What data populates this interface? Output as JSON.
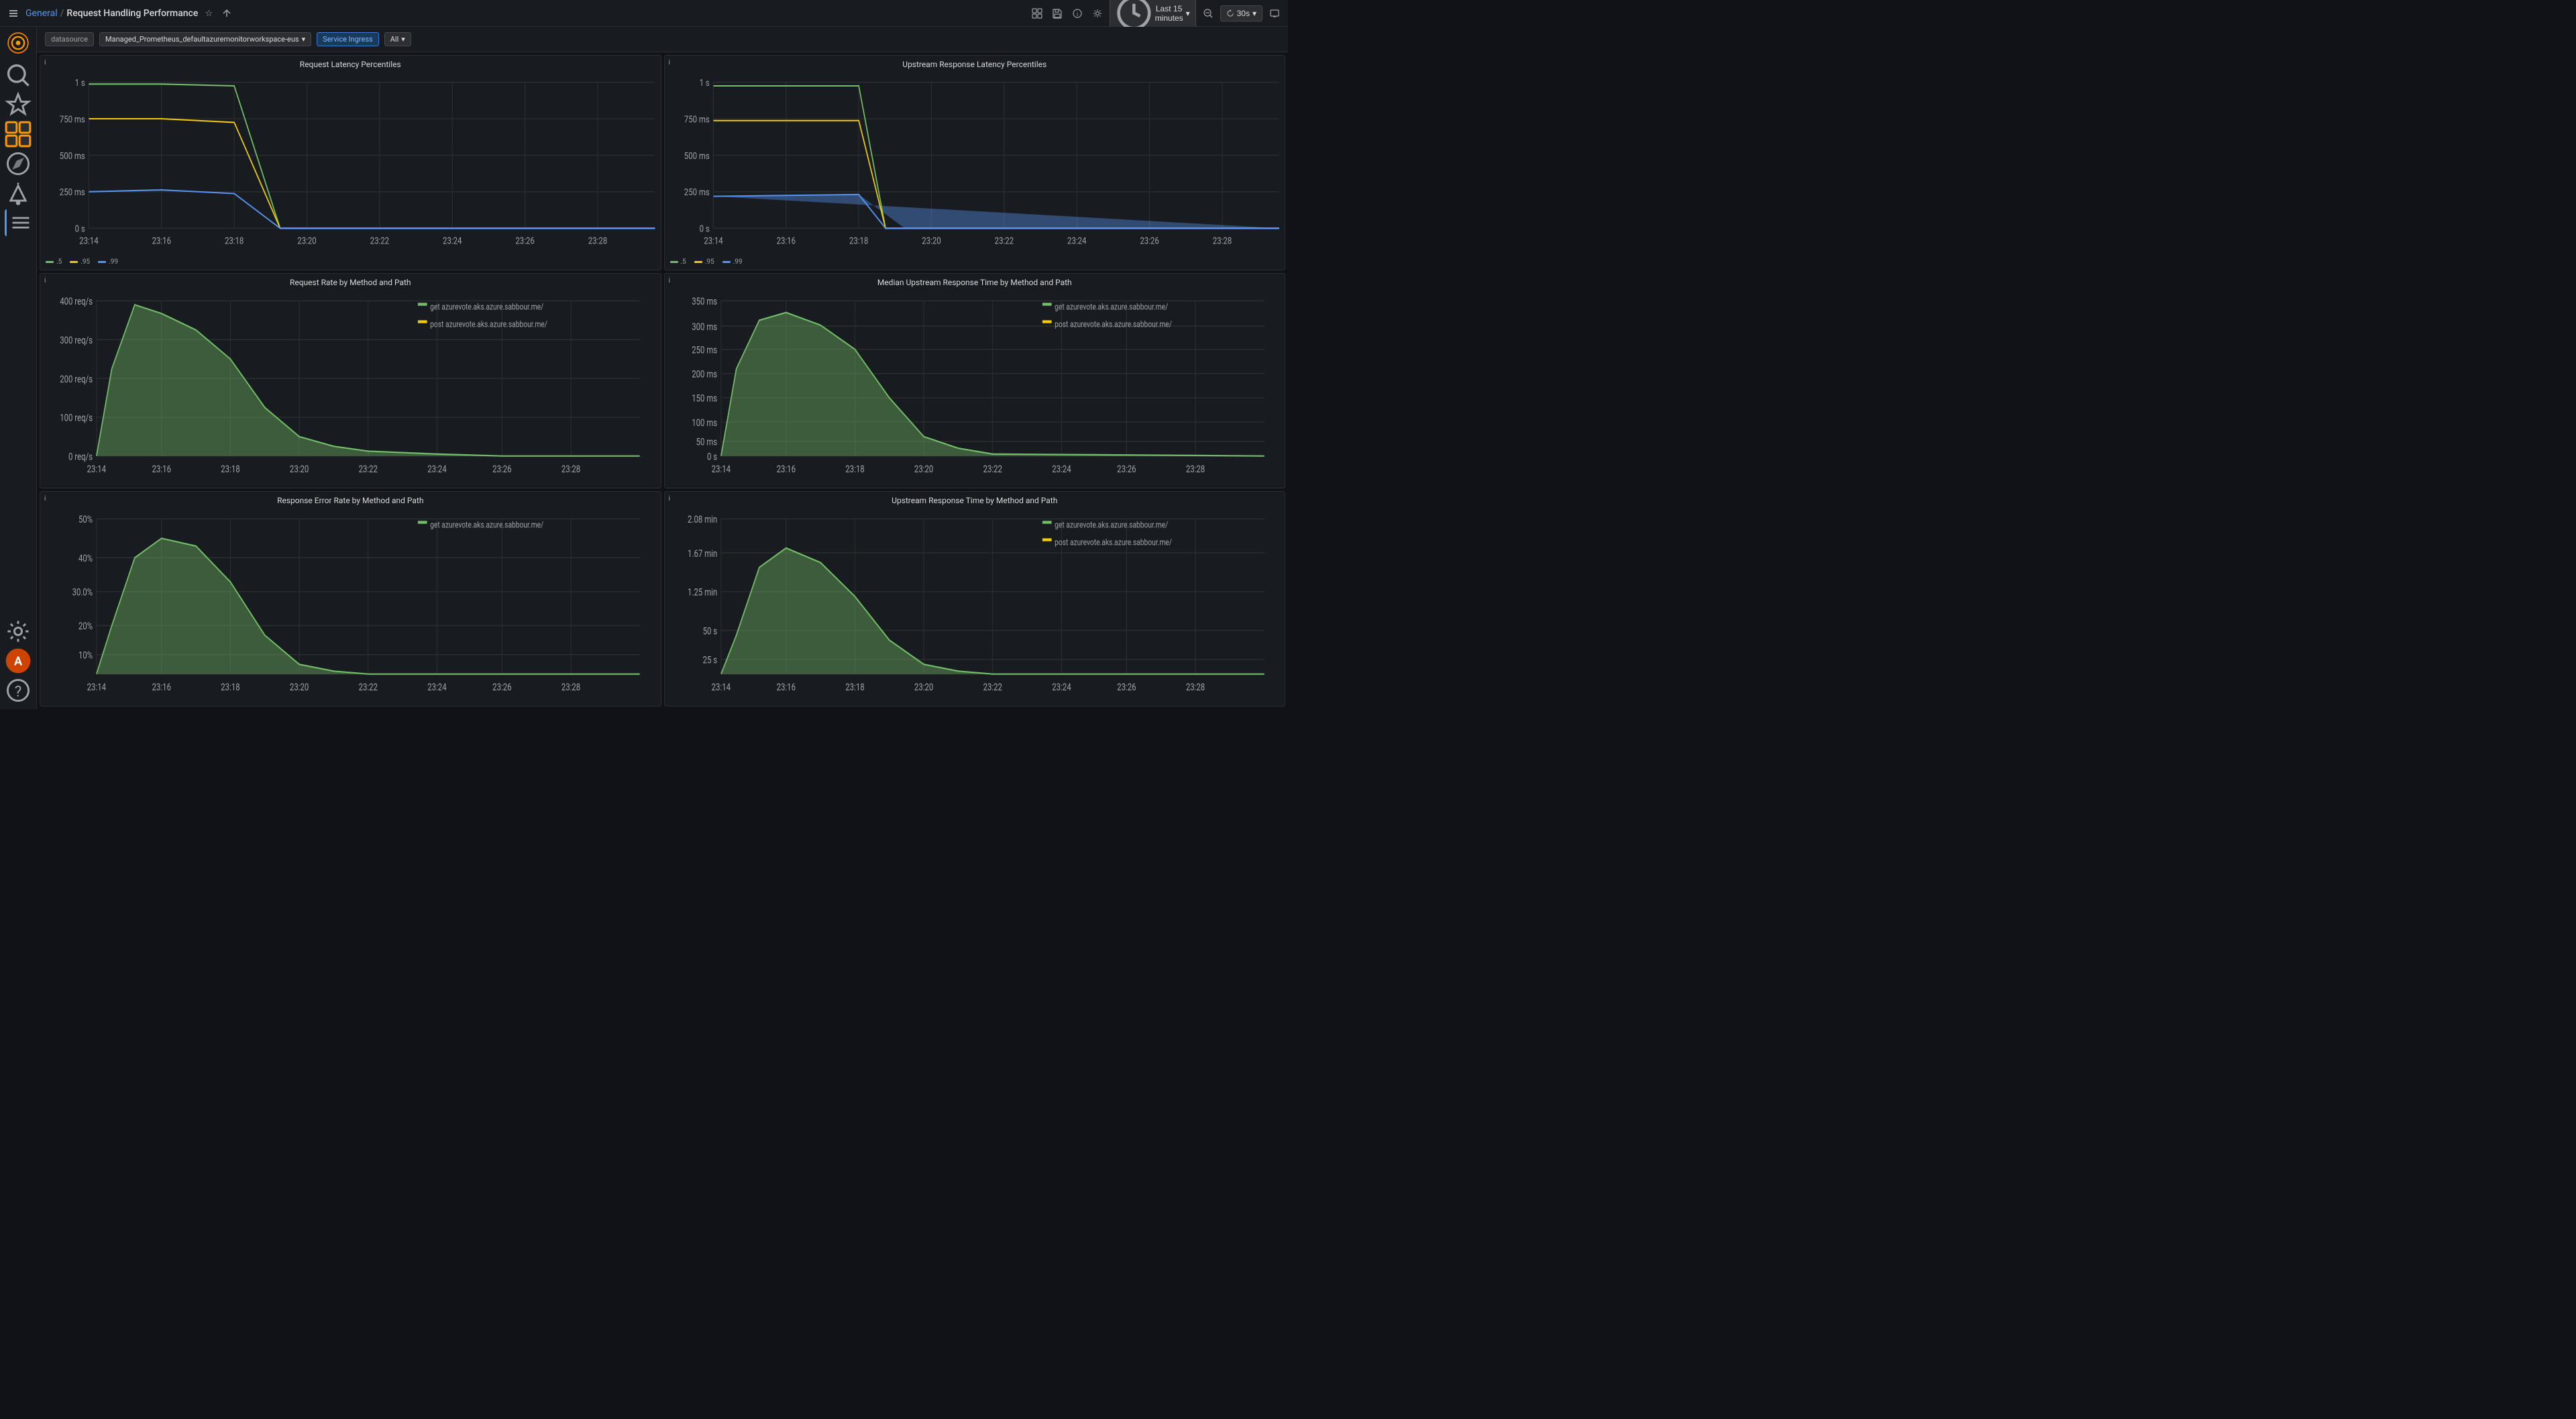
{
  "topbar": {
    "nav_general": "General",
    "nav_separator": "/",
    "nav_current": "Request Handling Performance",
    "star_icon": "★",
    "share_icon": "⤴",
    "add_panel_icon": "⊞",
    "save_icon": "💾",
    "info_icon": "ℹ",
    "settings_icon": "⚙",
    "time_icon": "🕐",
    "time_range": "Last 15 minutes",
    "zoom_out_icon": "⊖",
    "refresh_interval": "30s",
    "tv_icon": "▣"
  },
  "sidebar": {
    "logo": "🔥",
    "items": [
      {
        "id": "search",
        "icon": "🔍",
        "label": "Search"
      },
      {
        "id": "starred",
        "icon": "★",
        "label": "Starred"
      },
      {
        "id": "dashboards",
        "icon": "⊞",
        "label": "Dashboards",
        "active": true
      },
      {
        "id": "explore",
        "icon": "⊙",
        "label": "Explore"
      },
      {
        "id": "alerting",
        "icon": "🔔",
        "label": "Alerting"
      },
      {
        "id": "configuration",
        "icon": "≡",
        "label": "Configuration"
      }
    ],
    "bottom_items": [
      {
        "id": "settings",
        "icon": "⚙",
        "label": "Settings"
      },
      {
        "id": "user",
        "icon": "👤",
        "label": "User"
      },
      {
        "id": "help",
        "icon": "?",
        "label": "Help"
      }
    ]
  },
  "filterbar": {
    "datasource_label": "datasource",
    "datasource_value": "Managed_Prometheus_defaultazuremonitorworkspace-eus",
    "service_ingress_label": "Service Ingress",
    "all_label": "All",
    "chevron": "▾"
  },
  "panels": {
    "request_latency": {
      "title": "Request Latency Percentiles",
      "legend": [
        {
          "label": ".5",
          "color": "#73bf69"
        },
        {
          "label": ".95",
          "color": "#f2cc0c"
        },
        {
          "label": ".99",
          "color": "#5794f2"
        }
      ],
      "y_labels": [
        "1 s",
        "750 ms",
        "500 ms",
        "250 ms",
        "0 s"
      ],
      "x_labels": [
        "23:14",
        "23:16",
        "23:18",
        "23:20",
        "23:22",
        "23:24",
        "23:26",
        "23:28"
      ]
    },
    "upstream_latency": {
      "title": "Upstream Response Latency Percentiles",
      "legend": [
        {
          "label": ".5",
          "color": "#73bf69"
        },
        {
          "label": ".95",
          "color": "#f2cc0c"
        },
        {
          "label": ".99",
          "color": "#5794f2"
        }
      ],
      "y_labels": [
        "1 s",
        "750 ms",
        "500 ms",
        "250 ms",
        "0 s"
      ],
      "x_labels": [
        "23:14",
        "23:16",
        "23:18",
        "23:20",
        "23:22",
        "23:24",
        "23:26",
        "23:28"
      ]
    },
    "request_rate": {
      "title": "Request Rate by Method and Path",
      "legend": [
        {
          "label": "get azurevote.aks.azure.sabbour.me/",
          "color": "#73bf69"
        },
        {
          "label": "post azurevote.aks.azure.sabbour.me/",
          "color": "#f2cc0c"
        }
      ],
      "y_labels": [
        "400 req/s",
        "300 req/s",
        "200 req/s",
        "100 req/s",
        "0 req/s"
      ],
      "x_labels": [
        "23:14",
        "23:16",
        "23:18",
        "23:20",
        "23:22",
        "23:24",
        "23:26",
        "23:28"
      ]
    },
    "median_upstream": {
      "title": "Median Upstream Response Time by Method and Path",
      "legend": [
        {
          "label": "get azurevote.aks.azure.sabbour.me/",
          "color": "#73bf69"
        },
        {
          "label": "post azurevote.aks.azure.sabbour.me/",
          "color": "#f2cc0c"
        }
      ],
      "y_labels": [
        "350 ms",
        "300 ms",
        "250 ms",
        "200 ms",
        "150 ms",
        "100 ms",
        "50 ms",
        "0 s"
      ],
      "x_labels": [
        "23:14",
        "23:16",
        "23:18",
        "23:20",
        "23:22",
        "23:24",
        "23:26",
        "23:28"
      ]
    },
    "error_rate": {
      "title": "Response Error Rate by Method and Path",
      "legend": [
        {
          "label": "get azurevote.aks.azure.sabbour.me/",
          "color": "#73bf69"
        }
      ],
      "y_labels": [
        "50%",
        "40%",
        "30.0%",
        "20%",
        "10%"
      ],
      "x_labels": [
        "23:14",
        "23:16",
        "23:18",
        "23:20",
        "23:22",
        "23:24",
        "23:26",
        "23:28"
      ]
    },
    "upstream_response_time": {
      "title": "Upstream Response Time by Method and Path",
      "legend": [
        {
          "label": "get azurevote.aks.azure.sabbour.me/",
          "color": "#73bf69"
        },
        {
          "label": "post azurevote.aks.azure.sabbour.me/",
          "color": "#f2cc0c"
        }
      ],
      "y_labels": [
        "2.08 min",
        "1.67 min",
        "1.25 min",
        "50 s",
        "25 s"
      ],
      "x_labels": [
        "23:14",
        "23:16",
        "23:18",
        "23:20",
        "23:22",
        "23:24",
        "23:26",
        "23:28"
      ]
    }
  }
}
